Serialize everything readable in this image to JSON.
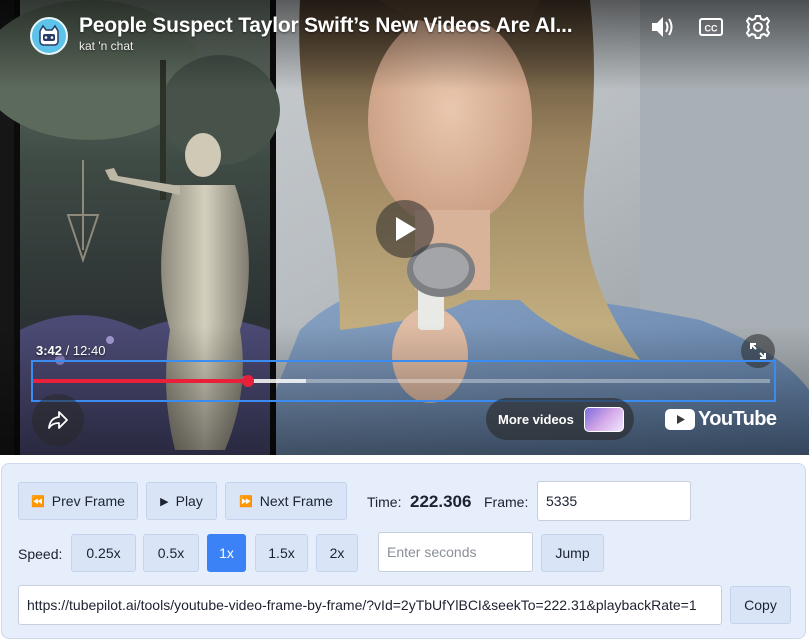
{
  "player": {
    "title": "People Suspect Taylor Swift’s New Videos Are AI...",
    "channel": "kat 'n chat",
    "current_time": "3:42",
    "separator": "/",
    "duration": "12:40",
    "progress_fraction": 0.2921,
    "buffered_fraction": 0.37,
    "more_videos_label": "More videos",
    "logo_text": "YouTube",
    "icons": {
      "avatar": "cat-avatar-icon",
      "volume": "volume-icon",
      "captions": "cc-icon",
      "settings": "gear-icon",
      "play": "play-icon",
      "fullscreen": "fullscreen-icon",
      "share": "share-icon",
      "logo": "youtube-logo-icon"
    },
    "colors": {
      "progress": "#e8203a",
      "highlight": "#3b8cf0"
    }
  },
  "controls": {
    "prev_frame_label": "Prev Frame",
    "play_label": "Play",
    "next_frame_label": "Next Frame",
    "time_label": "Time:",
    "time_value": "222.306",
    "frame_label": "Frame:",
    "frame_value": "5335",
    "speed_label": "Speed:",
    "speeds": [
      "0.25x",
      "0.5x",
      "1x",
      "1.5x",
      "2x"
    ],
    "active_speed": "1x",
    "seconds_placeholder": "Enter seconds",
    "jump_label": "Jump",
    "url_value": "https://tubepilot.ai/tools/youtube-video-frame-by-frame/?vId=2yTbUfYlBCI&seekTo=222.31&playbackRate=1",
    "copy_label": "Copy",
    "colors": {
      "active_speed_bg": "#3b82f6",
      "panel_bg": "#e7eefb",
      "button_bg": "#d9e5f7"
    }
  }
}
